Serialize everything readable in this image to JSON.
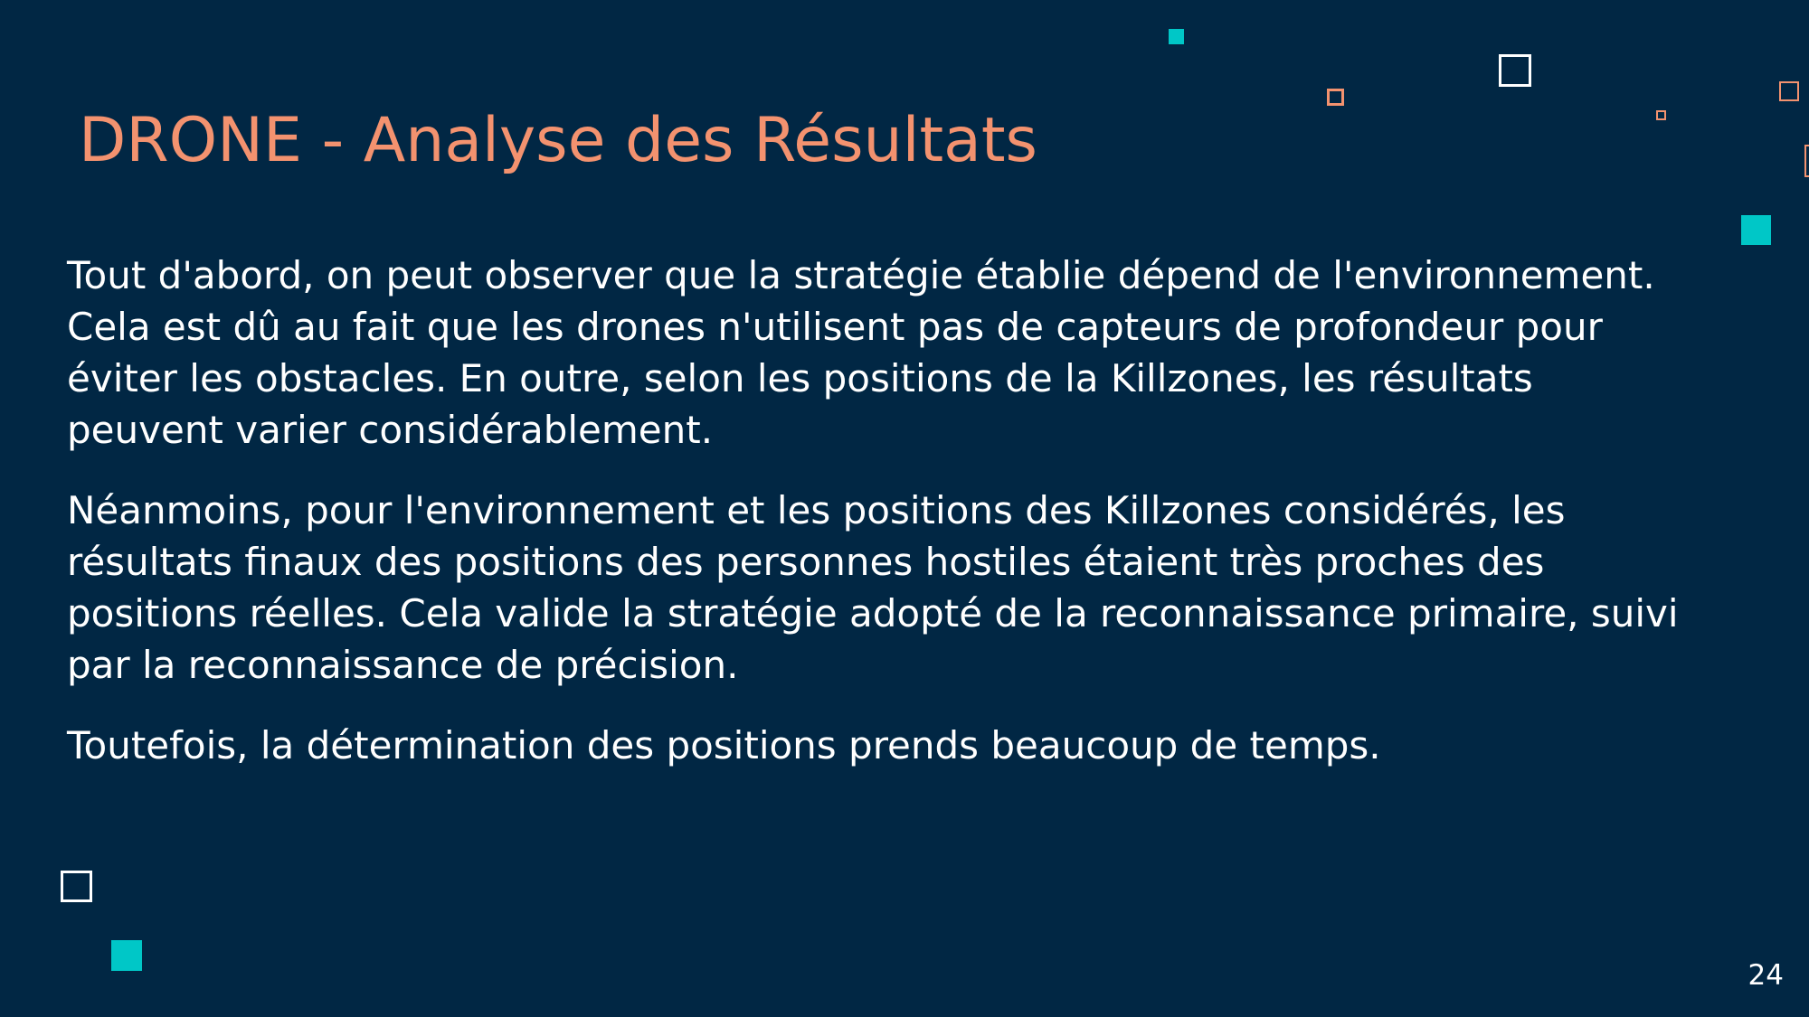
{
  "slide": {
    "title": "DRONE - Analyse des Résultats",
    "paragraphs": [
      "Tout d'abord, on peut observer que la stratégie établie dépend de l'environnement. Cela est dû au fait que les drones n'utilisent pas de capteurs de profondeur pour éviter les obstacles. En outre, selon les positions de la Killzones, les résultats peuvent varier considérablement.",
      "Néanmoins, pour l'environnement et les positions des Killzones considérés, les résultats finaux des positions des personnes hostiles étaient très proches des positions réelles. Cela valide la stratégie adopté de la reconnaissance primaire, suivi par la reconnaissance de précision.",
      "Toutefois, la détermination des positions prends beaucoup de temps."
    ],
    "page_number": "24"
  },
  "colors": {
    "background": "#012744",
    "title": "#F3926F",
    "text": "#FFFFFF",
    "accent_teal": "#00C7C7",
    "accent_orange": "#F3926F"
  }
}
